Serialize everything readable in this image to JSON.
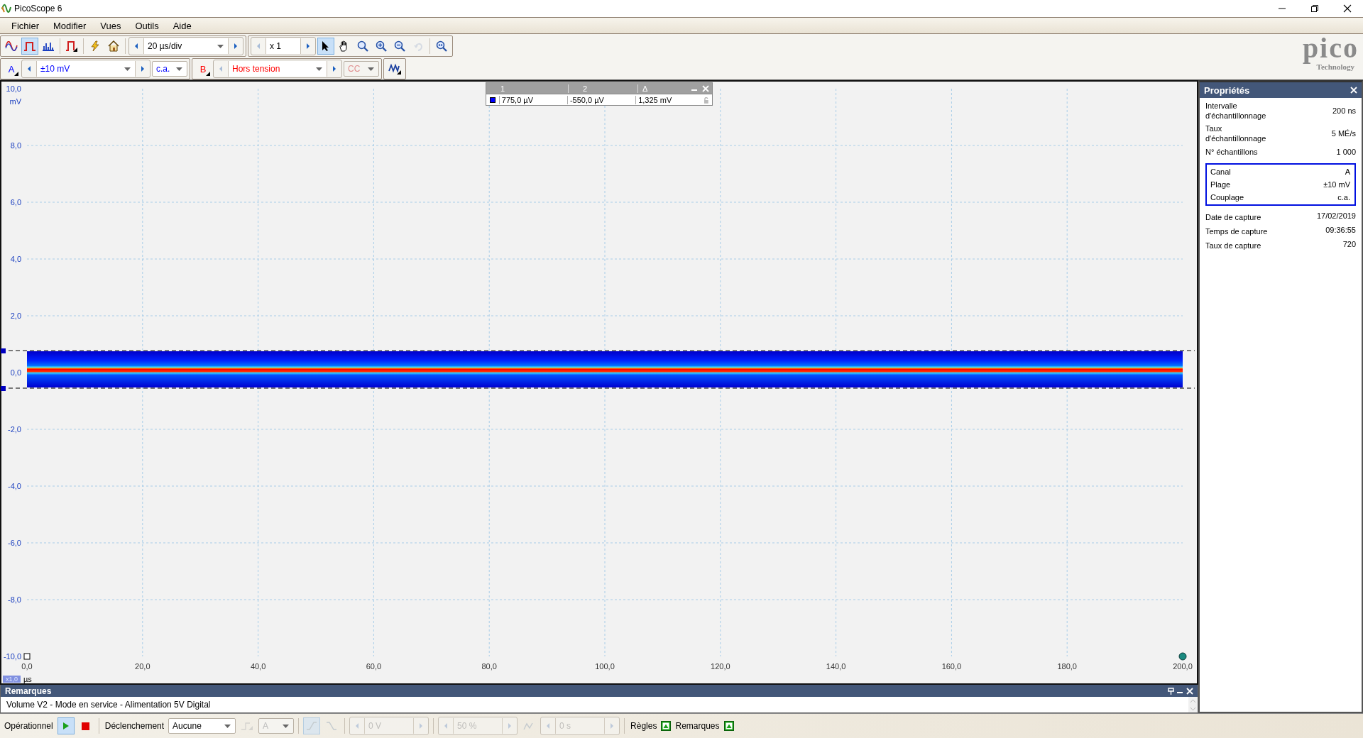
{
  "window": {
    "title": "PicoScope 6"
  },
  "menu": [
    "Fichier",
    "Modifier",
    "Vues",
    "Outils",
    "Aide"
  ],
  "toolbar": {
    "modes": [
      {
        "kind": "scope",
        "selected": false
      },
      {
        "kind": "persistence",
        "selected": true
      },
      {
        "kind": "spectrum",
        "selected": false
      }
    ],
    "timebase": "20 µs/div",
    "zoom": "x 1",
    "tools": [
      {
        "kind": "pointer",
        "selected": true
      },
      {
        "kind": "hand",
        "selected": false
      },
      {
        "kind": "zoom-area",
        "selected": false
      },
      {
        "kind": "zoom-in",
        "selected": false
      },
      {
        "kind": "zoom-out",
        "selected": false
      },
      {
        "kind": "undo",
        "selected": false,
        "disabled": true
      }
    ]
  },
  "logo": {
    "name": "pico",
    "tagline": "Technology"
  },
  "channels": [
    {
      "label": "A",
      "range": "±10 mV",
      "coupling": "c.a.",
      "color": "#0000ff",
      "prev_disabled": false,
      "coupling_disabled": false
    },
    {
      "label": "B",
      "range": "Hors tension",
      "coupling": "CC",
      "color": "#ff0000",
      "prev_disabled": true,
      "coupling_disabled": true
    }
  ],
  "plot": {
    "y_ticks": [
      "10,0",
      "8,0",
      "6,0",
      "4,0",
      "2,0",
      "0,0",
      "-2,0",
      "-4,0",
      "-6,0",
      "-8,0",
      "-10,0"
    ],
    "y_unit": "mV",
    "x_ticks": [
      "0,0",
      "20,0",
      "40,0",
      "60,0",
      "80,0",
      "100,0",
      "120,0",
      "140,0",
      "160,0",
      "180,0",
      "200,0"
    ],
    "x_unit": "µs",
    "x_scale": "x1,0"
  },
  "measurements": {
    "columns": [
      "1",
      "2",
      "Δ"
    ],
    "rows": [
      {
        "color": "#0000ff",
        "values": [
          "775,0 µV",
          "-550,0 µV",
          "1,325 mV"
        ]
      }
    ]
  },
  "properties": {
    "title": "Propriétés",
    "rows": [
      {
        "label": "Intervalle d'échantillonnage",
        "value": "200 ns"
      },
      {
        "label": "Taux d'échantillonnage",
        "value": "5 MÉ/s"
      },
      {
        "label": "N° échantillons",
        "value": "1 000"
      }
    ],
    "channel_rows": [
      {
        "label": "Canal",
        "value": "A"
      },
      {
        "label": "Plage",
        "value": "±10 mV"
      },
      {
        "label": "Couplage",
        "value": "c.a."
      }
    ],
    "capture_rows": [
      {
        "label": "Date de capture",
        "value": "17/02/2019"
      },
      {
        "label": "Temps de capture",
        "value": "09:36:55"
      },
      {
        "label": "Taux de capture",
        "value": "720"
      }
    ]
  },
  "notes": {
    "title": "Remarques",
    "text": "Volume V2 - Mode en service -  Alimentation 5V Digital"
  },
  "status": {
    "run_label": "Opérationnel",
    "running": true,
    "trigger_label": "Déclenchement",
    "trigger_mode": "Aucune",
    "trigger_source": "A",
    "threshold": "0 V",
    "pretrigger": "50 %",
    "delay": "0 s",
    "trigger_controls_disabled": true,
    "rulers_label": "Règles",
    "notes_label": "Remarques"
  }
}
